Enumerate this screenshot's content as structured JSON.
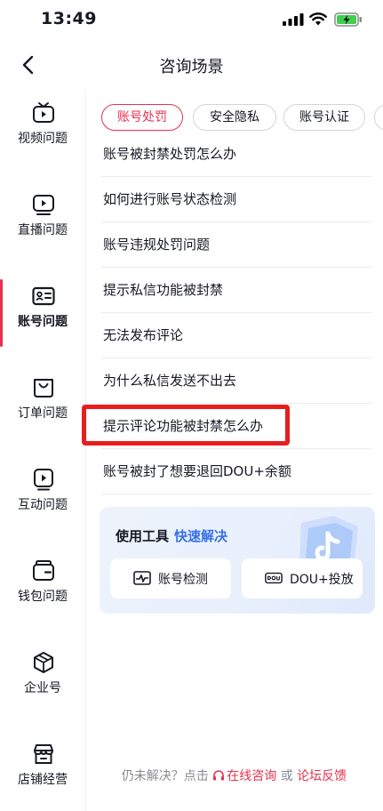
{
  "status_bar": {
    "time": "13:49"
  },
  "header": {
    "title": "咨询场景"
  },
  "sidebar": {
    "items": [
      {
        "label": "视频问题",
        "icon": "tv-icon",
        "active": false
      },
      {
        "label": "直播问题",
        "icon": "live-play-icon",
        "active": false
      },
      {
        "label": "账号问题",
        "icon": "id-card-icon",
        "active": true
      },
      {
        "label": "订单问题",
        "icon": "shopping-bag-icon",
        "active": false
      },
      {
        "label": "互动问题",
        "icon": "interact-play-icon",
        "active": false
      },
      {
        "label": "钱包问题",
        "icon": "wallet-icon",
        "active": false
      },
      {
        "label": "企业号",
        "icon": "cube-icon",
        "active": false
      },
      {
        "label": "店铺经营",
        "icon": "store-icon",
        "active": false
      }
    ]
  },
  "chips": {
    "items": [
      {
        "label": "账号处罚",
        "active": true
      },
      {
        "label": "安全隐私",
        "active": false
      },
      {
        "label": "账号认证",
        "active": false
      }
    ]
  },
  "questions": {
    "items": [
      "账号被封禁处罚怎么办",
      "如何进行账号状态检测",
      "账号违规处罚问题",
      "提示私信功能被封禁",
      "无法发布评论",
      "为什么私信发送不出去",
      "提示评论功能被封禁怎么办",
      "账号被封了想要退回DOU+余额"
    ]
  },
  "tools": {
    "title": "使用工具",
    "title_accent": "快速解决",
    "buttons": [
      {
        "label": "账号检测",
        "icon": "pulse-icon"
      },
      {
        "label": "DOU+投放",
        "icon": "dou-icon"
      }
    ]
  },
  "footer": {
    "prefix": "仍未解决？点击",
    "online_label": "在线咨询",
    "or_label": "或",
    "forum_label": "论坛反馈"
  },
  "colors": {
    "accent": "#e8304f",
    "tools_accent": "#3771e8",
    "highlight": "#e81e1e"
  }
}
